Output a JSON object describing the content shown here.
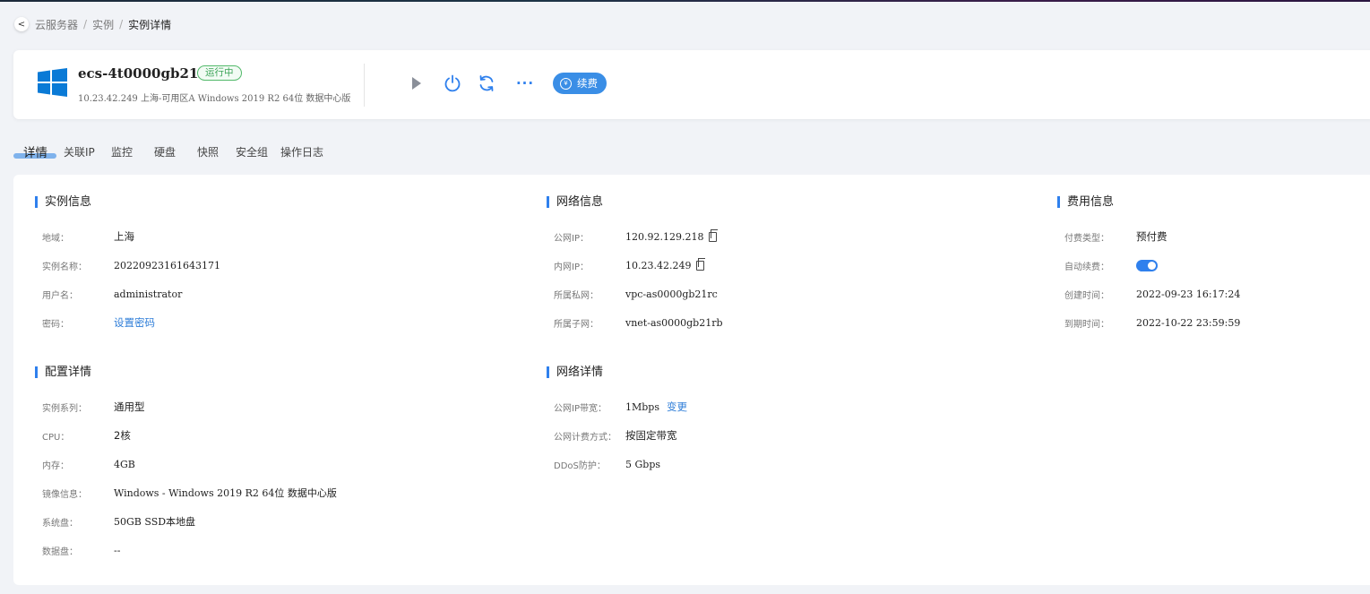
{
  "breadcrumb": {
    "back_icon": "chevron-left-icon",
    "items": [
      "云服务器",
      "实例",
      "实例详情"
    ],
    "separator": "/"
  },
  "instance": {
    "os_icon": "windows-logo-icon",
    "name": "ecs-4t0000gb21my",
    "status": "运行中",
    "subtitle": "10.23.42.249  上海-可用区A  Windows 2019 R2 64位 数据中心版"
  },
  "actions": {
    "start_icon": "play-icon",
    "power_icon": "power-icon",
    "restart_icon": "refresh-icon",
    "more_icon": "more-horizontal-icon",
    "more_glyph": "···",
    "renew_label": "续费",
    "renew_icon": "yen-circle-icon",
    "renew_glyph": "¥"
  },
  "tabs": [
    "详情",
    "关联IP",
    "监控",
    "硬盘",
    "快照",
    "安全组",
    "操作日志"
  ],
  "active_tab": "详情",
  "sections": {
    "instance_info": {
      "title": "实例信息",
      "rows": [
        {
          "label": "地域：",
          "value": "上海"
        },
        {
          "label": "实例名称：",
          "value": "20220923161643171"
        },
        {
          "label": "用户名：",
          "value": "administrator"
        },
        {
          "label": "密码：",
          "value": "设置密码"
        }
      ]
    },
    "network_info": {
      "title": "网络信息",
      "rows": [
        {
          "label": "公网IP：",
          "value": "120.92.129.218"
        },
        {
          "label": "内网IP：",
          "value": "10.23.42.249"
        },
        {
          "label": "所属私网：",
          "value": "vpc-as0000gb21rc"
        },
        {
          "label": "所属子网：",
          "value": "vnet-as0000gb21rb"
        }
      ]
    },
    "billing_info": {
      "title": "费用信息",
      "rows": [
        {
          "label": "付费类型：",
          "value": "预付费"
        },
        {
          "label": "自动续费：",
          "value": "on"
        },
        {
          "label": "创建时间：",
          "value": "2022-09-23 16:17:24"
        },
        {
          "label": "到期时间：",
          "value": "2022-10-22 23:59:59"
        }
      ]
    },
    "config_details": {
      "title": "配置详情",
      "rows": [
        {
          "label": "实例系列：",
          "value": "通用型"
        },
        {
          "label": "CPU：",
          "value": "2核"
        },
        {
          "label": "内存：",
          "value": "4GB"
        },
        {
          "label": "镜像信息：",
          "value": "Windows - Windows 2019 R2 64位 数据中心版"
        },
        {
          "label": "系统盘：",
          "value": "50GB SSD本地盘"
        },
        {
          "label": "数据盘：",
          "value": "--"
        }
      ]
    },
    "network_details": {
      "title": "网络详情",
      "rows": [
        {
          "label": "公网IP带宽：",
          "value": "1Mbps",
          "link": "变更"
        },
        {
          "label": "公网计费方式：",
          "value": "按固定带宽"
        },
        {
          "label": "DDoS防护：",
          "value": "5 Gbps"
        }
      ]
    }
  },
  "colors": {
    "accent": "#2f80ed",
    "status_green": "#3aa356",
    "windows_blue": "#0a7ad6"
  }
}
